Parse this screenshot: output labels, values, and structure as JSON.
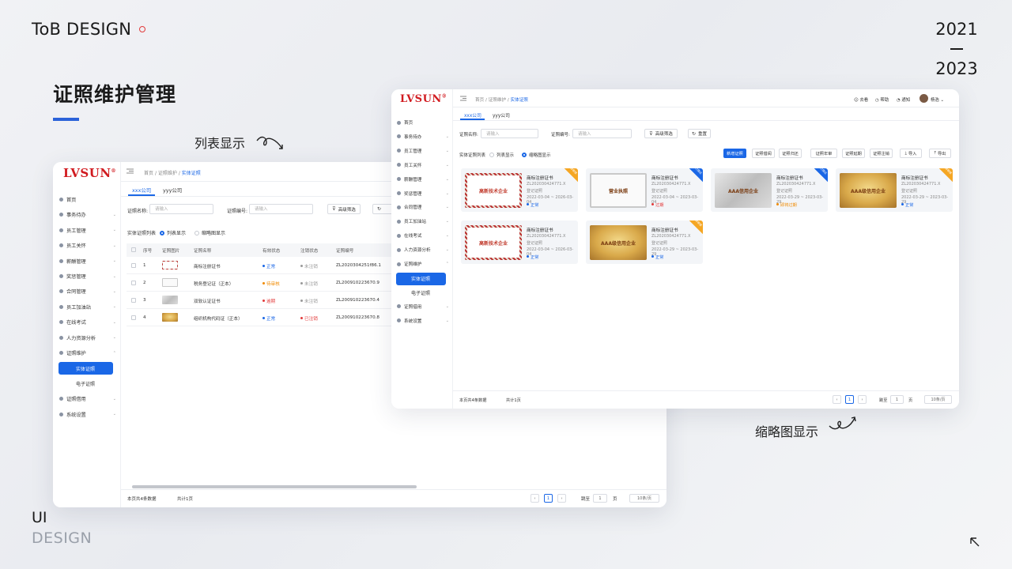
{
  "brand": "ToB DESIGN",
  "years": {
    "start": "2021",
    "end": "2023"
  },
  "page_title": "证照维护管理",
  "caption_list": "列表显示",
  "caption_thumb": "缩略图显示",
  "footer": {
    "ui": "UI",
    "design": "DESIGN"
  },
  "app": {
    "logo": "LVSUN",
    "logo_mark": "®",
    "nav": [
      {
        "label": "首页",
        "arrow": ""
      },
      {
        "label": "事务待办",
        "arrow": "⌄"
      },
      {
        "label": "员工管理",
        "arrow": "⌄"
      },
      {
        "label": "员工关怀",
        "arrow": "⌄"
      },
      {
        "label": "薪酬管理",
        "arrow": "⌄"
      },
      {
        "label": "奖惩管理",
        "arrow": "⌄"
      },
      {
        "label": "合同管理",
        "arrow": "⌄"
      },
      {
        "label": "员工加油站",
        "arrow": "⌄"
      },
      {
        "label": "在线考试",
        "arrow": "⌄"
      },
      {
        "label": "人力资源分析",
        "arrow": "⌄"
      },
      {
        "label": "证照维护",
        "arrow": "⌃"
      },
      {
        "label": "证照借用",
        "arrow": "⌄"
      },
      {
        "label": "系统设置",
        "arrow": "⌄"
      }
    ],
    "nav_sub": {
      "active": "实体证照",
      "other": "电子证照"
    },
    "breadcrumb": {
      "home": "首页",
      "mid": "证照维护",
      "current": "实体证照",
      "sep": "/"
    },
    "tabs": [
      "xxx公司",
      "yyy公司"
    ],
    "filter": {
      "name_label": "证照名称:",
      "name_placeholder": "请输入",
      "code_label": "证照编号:",
      "code_placeholder": "请输入",
      "advanced": "高级筛选",
      "reset": "重置"
    },
    "view": {
      "label": "实体证照列表",
      "list": "列表显示",
      "thumb": "缩略图显示"
    },
    "table": {
      "headers": [
        "序号",
        "证照图片",
        "证照名称",
        "有效状态",
        "注销状态",
        "证照编号"
      ],
      "rows": [
        {
          "no": "1",
          "name": "商标注册证书",
          "valid": "正常",
          "valid_color": "#1a67e6",
          "cancel": "未注销",
          "code": "ZL2020304251f86.1"
        },
        {
          "no": "2",
          "name": "税务登记证（正本）",
          "valid": "待审核",
          "valid_color": "#f08a00",
          "cancel": "未注销",
          "code": "ZL200910223670.9"
        },
        {
          "no": "3",
          "name": "双软认证证书",
          "valid": "逾期",
          "valid_color": "#e23b3b",
          "cancel": "未注销",
          "code": "ZL200910223670.4"
        },
        {
          "no": "4",
          "name": "组织机构代码证（正本）",
          "valid": "正常",
          "valid_color": "#1a67e6",
          "cancel": "已注销",
          "code": "ZL200910223670.8"
        }
      ]
    },
    "footer": {
      "total": "本页共4条数据",
      "pages": "共计1页",
      "page": "1",
      "goto": "跳至",
      "page_unit": "页",
      "goto_value": "1",
      "page_size": "10条/页"
    },
    "header_right": {
      "search": "去看",
      "help": "帮助",
      "notice": "通知",
      "user": "杨浩"
    },
    "actions": {
      "new": "新增证照",
      "renew": "证照借阅",
      "return": "证照归还",
      "annual": "证照年审",
      "extend": "证照延期",
      "cancel": "证照注销",
      "import": "导入",
      "export": "导出"
    },
    "cards": [
      {
        "title": "商标注册证书",
        "code": "ZL202030424771.X",
        "type": "登记证照",
        "date": "2022-03-04 ~ 2026-03-04",
        "status": "正常",
        "status_color": "#1a67e6",
        "ribbon": "待审核",
        "ribbon_color": "#f5a623",
        "img": "cert-red",
        "img_text": "高新技术企业"
      },
      {
        "title": "商标注册证书",
        "code": "ZL202030424771.X",
        "type": "登记证照",
        "date": "2022-03-04 ~ 2023-03-04",
        "status": "过期",
        "status_color": "#e23b3b",
        "ribbon": "已借出",
        "ribbon_color": "#1a67e6",
        "img": "whitec",
        "img_text": "营业执照"
      },
      {
        "title": "商标注册证书",
        "code": "ZL202030424771.X",
        "type": "登记证照",
        "date": "2022-03-29 ~ 2023-03-29",
        "status": "即将过期",
        "status_color": "#f08a00",
        "ribbon": "已借出",
        "ribbon_color": "#1a67e6",
        "img": "grey",
        "img_text": "AAA信用企业"
      },
      {
        "title": "商标注册证书",
        "code": "ZL202030424771.X",
        "type": "登记证照",
        "date": "2022-03-29 ~ 2023-03-29",
        "status": "正常",
        "status_color": "#1a67e6",
        "ribbon": "待审核",
        "ribbon_color": "#f5a623",
        "img": "gold",
        "img_text": "AAA级信用企业"
      },
      {
        "title": "商标注册证书",
        "code": "ZL202030424771.X",
        "type": "登记证照",
        "date": "2022-03-04 ~ 2026-03-04",
        "status": "正常",
        "status_color": "#1a67e6",
        "ribbon": "",
        "ribbon_color": "",
        "img": "cert-red",
        "img_text": "高新技术企业"
      },
      {
        "title": "商标注册证书",
        "code": "ZL202030424771.X",
        "type": "登记证照",
        "date": "2022-03-29 ~ 2023-03-29",
        "status": "正常",
        "status_color": "#1a67e6",
        "ribbon": "待审核",
        "ribbon_color": "#f5a623",
        "img": "gold",
        "img_text": "AAA级信用企业"
      }
    ]
  }
}
